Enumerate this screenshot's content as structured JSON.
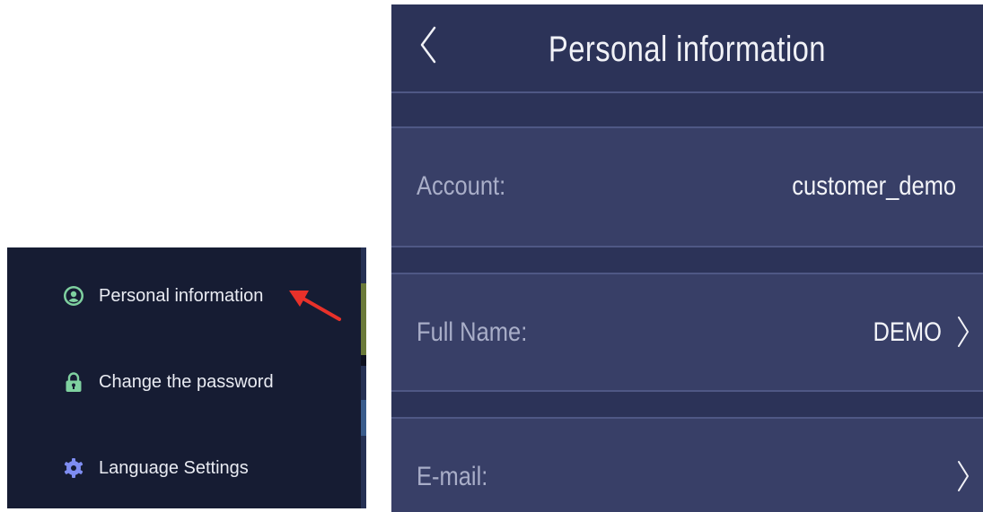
{
  "menu": {
    "items": [
      {
        "label": "Personal information",
        "icon": "user-circle-icon"
      },
      {
        "label": "Change the password",
        "icon": "lock-icon"
      },
      {
        "label": "Language Settings",
        "icon": "gear-icon"
      }
    ]
  },
  "screen": {
    "title": "Personal information",
    "rows": [
      {
        "label": "Account:",
        "value": "customer_demo"
      },
      {
        "label": "Full Name:",
        "value": "DEMO"
      },
      {
        "label": "E-mail:",
        "value": ""
      }
    ]
  },
  "colors": {
    "menu_bg": "#161c33",
    "screen_bg": "#2c3358",
    "row_bg": "#383f67",
    "accent_green": "#7fd1a0",
    "accent_blue": "#7f8df2",
    "arrow_red": "#e8312a"
  }
}
